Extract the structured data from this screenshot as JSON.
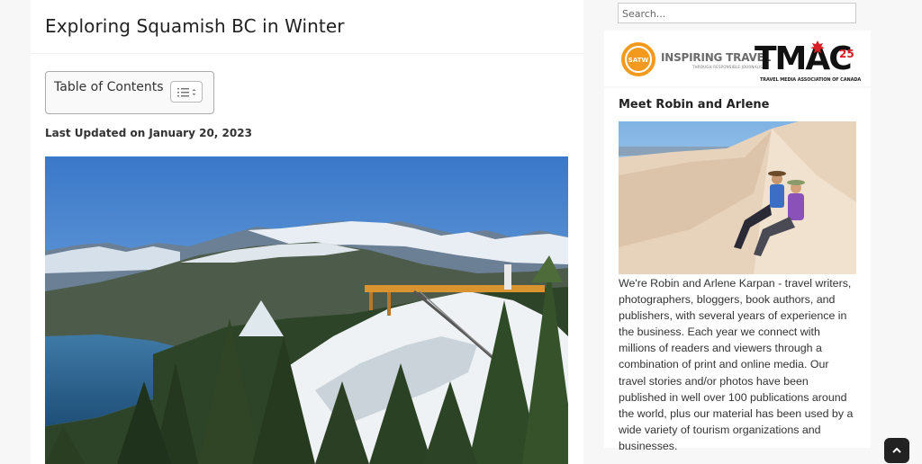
{
  "post": {
    "title": "Exploring Squamish BC in Winter",
    "toc_label": "Table of Contents",
    "updated": "Last Updated on January 20, 2023"
  },
  "sidebar": {
    "search_placeholder": "Search...",
    "logos": {
      "satw_badge": "SATW",
      "satw_name": "INSPIRING TRAVEL",
      "satw_tagline": "THROUGH RESPONSIBLE JOURNALISM",
      "tmac_name": "TMAC",
      "tmac_years": "25",
      "tmac_full": "TRAVEL MEDIA ASSOCIATION OF CANADA"
    },
    "about": {
      "title": "Meet Robin and Arlene",
      "text": "We're Robin and Arlene Karpan - travel writers, photographers, bloggers, book authors, and publishers, with several years of experience in the business. Each year we connect with millions of readers and viewers through a combination of print and online media. Our travel stories and/or photos have been published in well over 100 publications around the world, plus our material has been used by a wide variety of tourism organizations and businesses."
    }
  },
  "icons": {
    "toc_toggle": "list-toggle-icon",
    "scroll_top": "chevron-up-icon"
  },
  "colors": {
    "satw_orange": "#f39a1e",
    "tmac_red": "#d62027"
  }
}
